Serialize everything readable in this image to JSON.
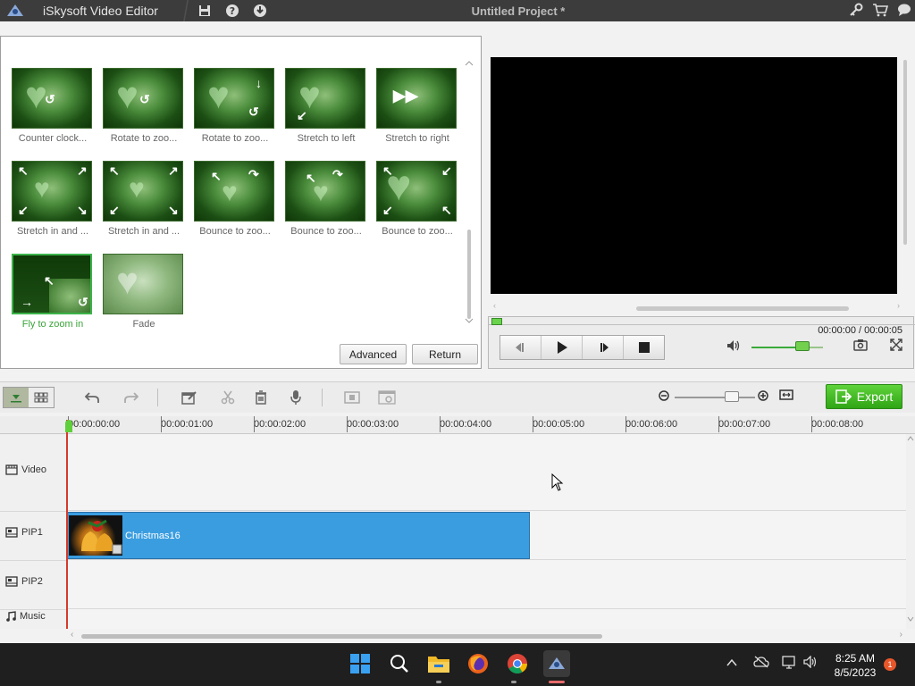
{
  "titlebar": {
    "app_name": "iSkysoft Video Editor",
    "project_title": "Untitled Project *",
    "icons": [
      "save-icon",
      "help-icon",
      "download-icon",
      "key-icon",
      "cart-icon",
      "chat-icon"
    ]
  },
  "effects": {
    "items": [
      {
        "label": "Counter clock..."
      },
      {
        "label": "Rotate to zoo..."
      },
      {
        "label": "Rotate to zoo..."
      },
      {
        "label": "Stretch to left"
      },
      {
        "label": "Stretch to right"
      },
      {
        "label": "Stretch in and ..."
      },
      {
        "label": "Stretch in and ..."
      },
      {
        "label": "Bounce to zoo..."
      },
      {
        "label": "Bounce to zoo..."
      },
      {
        "label": "Bounce to zoo..."
      },
      {
        "label": "Fly to zoom in",
        "selected": true
      },
      {
        "label": "Fade"
      }
    ],
    "advanced_label": "Advanced",
    "return_label": "Return"
  },
  "preview": {
    "time_readout": "00:00:00 / 00:00:05",
    "volume_level": 0.7,
    "accent_color": "#5fcf3a"
  },
  "timeline_toolbar": {
    "export_label": "Export"
  },
  "ruler": {
    "ticks": [
      "00:00:00:00",
      "00:00:01:00",
      "00:00:02:00",
      "00:00:03:00",
      "00:00:04:00",
      "00:00:05:00",
      "00:00:06:00",
      "00:00:07:00",
      "00:00:08:00"
    ]
  },
  "tracks": {
    "video": "Video",
    "pip1": "PIP1",
    "pip2": "PIP2",
    "music": "Music"
  },
  "clip": {
    "label": "Christmas16",
    "color": "#3a9de0"
  },
  "taskbar": {
    "time": "8:25 AM",
    "date": "8/5/2023",
    "notifications": "1"
  }
}
